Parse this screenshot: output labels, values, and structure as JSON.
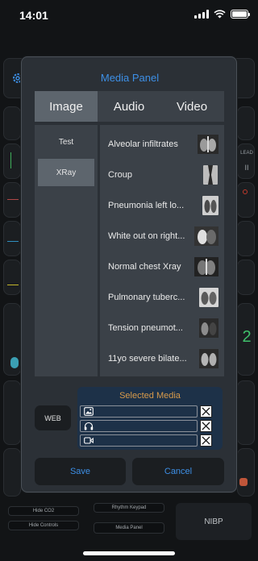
{
  "status_bar": {
    "time": "14:01",
    "battery_level": 1.0
  },
  "background": {
    "labels": [
      "LEAD",
      "II",
      "2"
    ],
    "buttons": [
      "Hide CO2",
      "Hide Controls",
      "Rhythm Keypad",
      "Media Panel"
    ],
    "nibp_label": "NIBP"
  },
  "modal": {
    "title": "Media Panel",
    "tabs": [
      "Image",
      "Audio",
      "Video"
    ],
    "active_tab": "Image",
    "categories": [
      "Test",
      "XRay"
    ],
    "active_category": "XRay",
    "items": [
      {
        "label": "Alveolar infiltrates",
        "thumb": "chest-xray-thumbnail"
      },
      {
        "label": "Croup",
        "thumb": "neck-xray-thumbnail"
      },
      {
        "label": "Pneumonia left lo...",
        "thumb": "chest-xray-thumbnail"
      },
      {
        "label": "White out on right...",
        "thumb": "chest-xray-thumbnail"
      },
      {
        "label": "Normal chest Xray",
        "thumb": "chest-xray-thumbnail"
      },
      {
        "label": "Pulmonary tuberc...",
        "thumb": "chest-xray-thumbnail"
      },
      {
        "label": "Tension pneumot...",
        "thumb": "chest-xray-thumbnail"
      },
      {
        "label": "11yo severe bilate...",
        "thumb": "chest-xray-thumbnail"
      }
    ],
    "web_label": "WEB",
    "selected_media": {
      "title": "Selected Media",
      "rows": [
        {
          "icon": "image-icon",
          "value": ""
        },
        {
          "icon": "headphones-icon",
          "value": ""
        },
        {
          "icon": "video-camera-icon",
          "value": ""
        }
      ]
    },
    "save_label": "Save",
    "cancel_label": "Cancel"
  },
  "colors": {
    "accent": "#3d8fe6",
    "selected_title": "#d89a4a",
    "modal_bg": "#2b3036",
    "panel_bg": "#3b4148",
    "active_bg": "#5d656d",
    "selected_box_bg": "#1d3148"
  }
}
